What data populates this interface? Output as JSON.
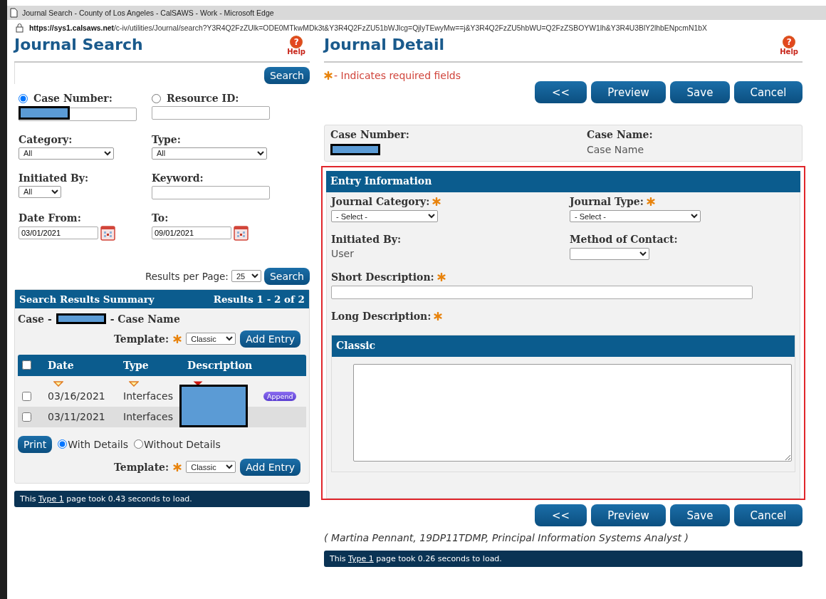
{
  "window": {
    "title": "Journal Search - County of Los Angeles - CalSAWS - Work - Microsoft Edge"
  },
  "address_bar": {
    "url_host": "https://sys1.calsaws.net",
    "url_path": "/c-iv/utilities/Journal/search?Y3R4Q2FzZUlk=ODE0MTkwMDk3t&Y3R4Q2FzZU51bWJlcg=QjlyTEwyMw==j&Y3R4Q2FzZU5hbWU=Q2FzZSBOYW1lh&Y3R4U3BlY2lhbENpcmN1bX"
  },
  "search_panel": {
    "title": "Journal Search",
    "help": {
      "icon": "?",
      "label": "Help"
    },
    "search_button": "Search",
    "id_options": [
      {
        "label": "Case Number:",
        "selected": true,
        "redacted": true
      },
      {
        "label": "Resource ID:",
        "selected": false,
        "redacted": false
      }
    ],
    "filters": [
      {
        "kind": "select",
        "label": "Category:",
        "value": "All"
      },
      {
        "kind": "select",
        "label": "Type:",
        "value": "All"
      },
      {
        "kind": "select",
        "label": "Initiated By:",
        "value": "All"
      },
      {
        "kind": "text",
        "label": "Keyword:"
      },
      {
        "kind": "date",
        "label": "Date From:",
        "value": "03/01/2021"
      },
      {
        "kind": "date",
        "label": "To:",
        "value": "09/01/2021"
      }
    ],
    "results_per_page": {
      "label": "Results per Page:",
      "value": "25",
      "button": "Search"
    },
    "results": {
      "title": "Search Results Summary",
      "count": "Results 1 - 2 of 2",
      "case_prefix": "Case -",
      "case_suffix": "- Case Name",
      "template": {
        "label": "Template:",
        "value": "Classic",
        "button": "Add Entry"
      },
      "select_all": {
        "checked": false
      },
      "columns": [
        {
          "label": "Date",
          "sorted": false
        },
        {
          "label": "Type",
          "sorted": false
        },
        {
          "label": "Description",
          "sorted": true
        }
      ],
      "rows": [
        {
          "checked": false,
          "date": "03/16/2021",
          "type": "Interfaces",
          "action": "Append"
        },
        {
          "checked": false,
          "date": "03/11/2021",
          "type": "Interfaces"
        }
      ],
      "print": {
        "button": "Print",
        "options": [
          {
            "label": "With Details",
            "selected": true
          },
          {
            "label": "Without Details",
            "selected": false
          }
        ]
      },
      "template_bottom": {
        "label": "Template:",
        "value": "Classic",
        "button": "Add Entry"
      }
    },
    "footer": {
      "prefix": "This",
      "link": "Type 1",
      "suffix": "page took 0.43 seconds to load."
    }
  },
  "detail_panel": {
    "title": "Journal Detail",
    "help": {
      "icon": "?",
      "label": "Help"
    },
    "required_note": "- Indicates required fields",
    "buttons": [
      "<<",
      "Preview",
      "Save",
      "Cancel"
    ],
    "case": {
      "number_label": "Case Number:",
      "name_label": "Case Name:",
      "name": "Case Name"
    },
    "entry": {
      "title": "Entry Information",
      "fields": [
        {
          "kind": "select",
          "label": "Journal Category:",
          "required": true,
          "value": "- Select -"
        },
        {
          "kind": "select",
          "label": "Journal Type:",
          "required": true,
          "value": "- Select -"
        },
        {
          "kind": "static",
          "label": "Initiated By:",
          "required": false,
          "value": "User"
        },
        {
          "kind": "select",
          "label": "Method of Contact:",
          "required": false
        },
        {
          "kind": "text",
          "label": "Short Description:",
          "required": true
        },
        {
          "kind": "label",
          "label": "Long Description:",
          "required": true
        }
      ],
      "template_title": "Classic"
    },
    "buttons_bottom": [
      "<<",
      "Preview",
      "Save",
      "Cancel"
    ],
    "signature": "( Martina Pennant, 19DP11TDMP, Principal Information Systems Analyst )",
    "footer": {
      "prefix": "This",
      "link": "Type 1",
      "suffix": "page took 0.26 seconds to load."
    }
  }
}
